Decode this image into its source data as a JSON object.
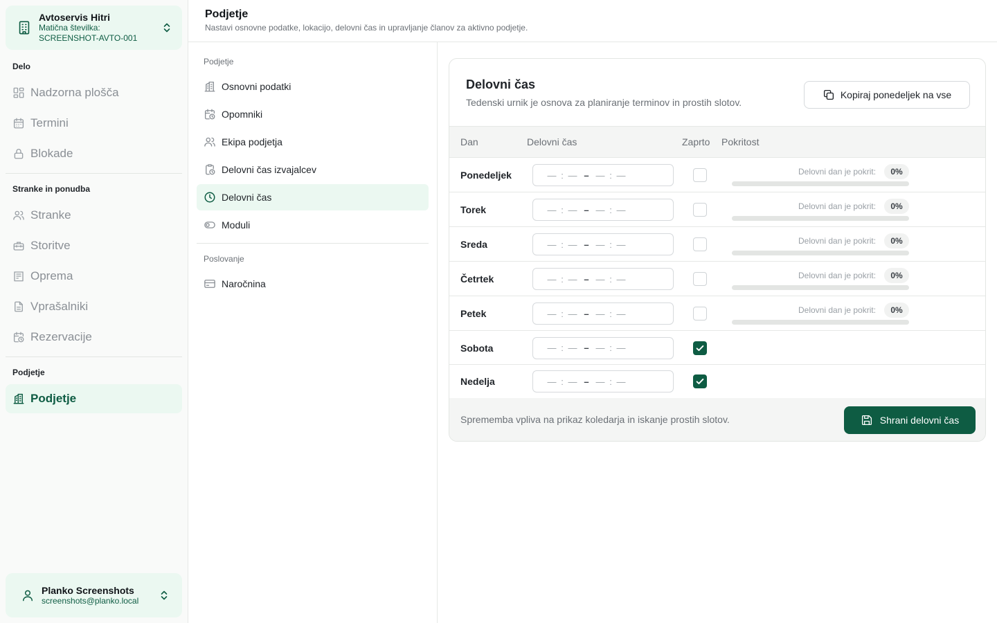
{
  "org": {
    "name": "Avtoservis Hitri",
    "id_line1": "Matična številka:",
    "id_line2": "SCREENSHOT-AVTO-001",
    "icon": "building-icon"
  },
  "sidebar": {
    "sections": [
      {
        "title": "Delo",
        "items": [
          {
            "label": "Nadzorna plošča",
            "icon": "dashboard-icon"
          },
          {
            "label": "Termini",
            "icon": "calendar-icon"
          },
          {
            "label": "Blokade",
            "icon": "lock-icon"
          }
        ]
      },
      {
        "title": "Stranke in ponudba",
        "items": [
          {
            "label": "Stranke",
            "icon": "users-icon"
          },
          {
            "label": "Storitve",
            "icon": "toolbox-icon"
          },
          {
            "label": "Oprema",
            "icon": "equipment-icon"
          },
          {
            "label": "Vprašalniki",
            "icon": "document-icon"
          },
          {
            "label": "Rezervacije",
            "icon": "calendar-clock-icon"
          }
        ]
      },
      {
        "title": "Podjetje",
        "items": [
          {
            "label": "Podjetje",
            "icon": "company-icon",
            "active": true
          }
        ]
      }
    ]
  },
  "user": {
    "name": "Planko Screenshots",
    "email": "screenshots@planko.local",
    "icon": "user-icon"
  },
  "header": {
    "title": "Podjetje",
    "subtitle": "Nastavi osnovne podatke, lokacijo, delovni čas in upravljanje članov za aktivno podjetje."
  },
  "subnav": {
    "section1_title": "Podjetje",
    "section1_items": [
      {
        "label": "Osnovni podatki",
        "icon": "building-icon"
      },
      {
        "label": "Opomniki",
        "icon": "calendar-clock-icon"
      },
      {
        "label": "Ekipa podjetja",
        "icon": "users-icon"
      },
      {
        "label": "Delovni čas izvajalcev",
        "icon": "clipboard-clock-icon"
      },
      {
        "label": "Delovni čas",
        "icon": "clock-icon",
        "active": true
      },
      {
        "label": "Moduli",
        "icon": "toggle-icon"
      }
    ],
    "section2_title": "Poslovanje",
    "section2_items": [
      {
        "label": "Naročnina",
        "icon": "credit-card-icon"
      }
    ]
  },
  "card": {
    "title": "Delovni čas",
    "subtitle": "Tedenski urnik je osnova za planiranje terminov in prostih slotov.",
    "copy_button": "Kopiraj ponedeljek na vse",
    "columns": {
      "day": "Dan",
      "hours": "Delovni čas",
      "closed": "Zaprto",
      "coverage": "Pokritost"
    },
    "time_placeholder": {
      "seg": "—",
      "colon": ":",
      "dash": "–"
    },
    "coverage_label": "Delovni dan je pokrit:",
    "days": [
      {
        "name": "Ponedeljek",
        "closed": false,
        "coverage": "0%",
        "coverage_fraction": 0
      },
      {
        "name": "Torek",
        "closed": false,
        "coverage": "0%",
        "coverage_fraction": 0
      },
      {
        "name": "Sreda",
        "closed": false,
        "coverage": "0%",
        "coverage_fraction": 0
      },
      {
        "name": "Četrtek",
        "closed": false,
        "coverage": "0%",
        "coverage_fraction": 0
      },
      {
        "name": "Petek",
        "closed": false,
        "coverage": "0%",
        "coverage_fraction": 0
      },
      {
        "name": "Sobota",
        "closed": true
      },
      {
        "name": "Nedelja",
        "closed": true
      }
    ],
    "footer_note": "Sprememba vpliva na prikaz koledarja in iskanje prostih slotov.",
    "save_button": "Shrani delovni čas"
  },
  "colors": {
    "accent": "#0e5c43",
    "accent_light": "#ebf8f1"
  }
}
